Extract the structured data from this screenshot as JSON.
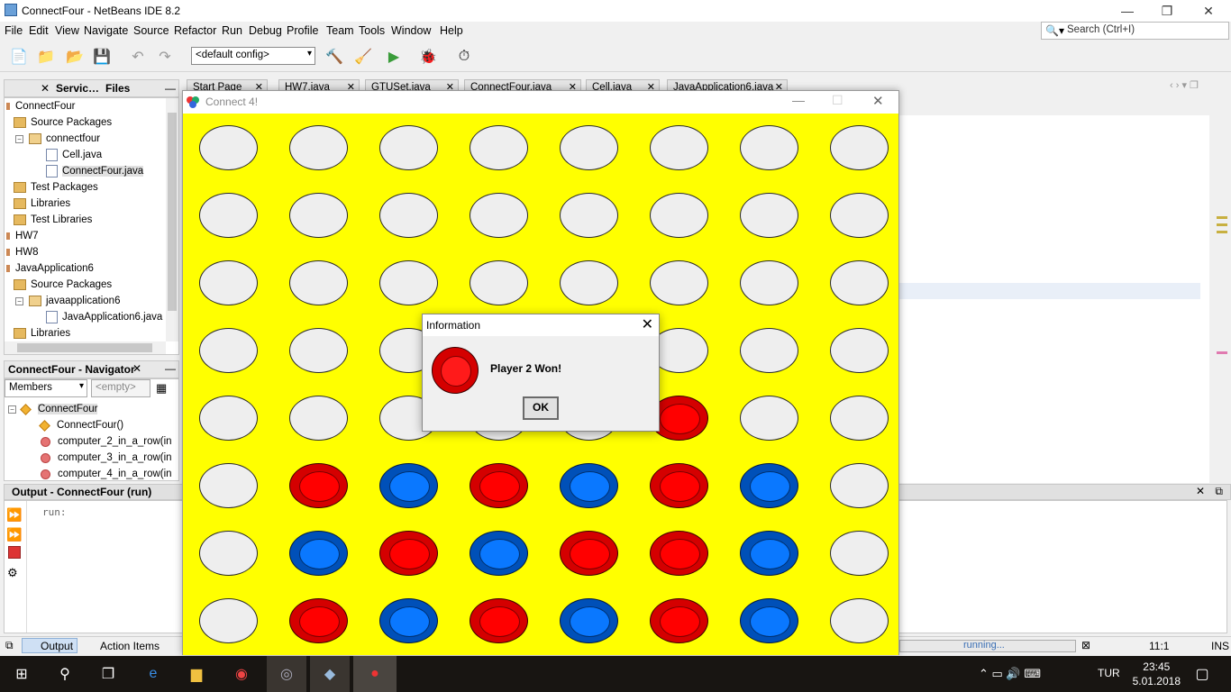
{
  "ide": {
    "title": "ConnectFour - NetBeans IDE 8.2",
    "menu": [
      "File",
      "Edit",
      "View",
      "Navigate",
      "Source",
      "Refactor",
      "Run",
      "Debug",
      "Profile",
      "Team",
      "Tools",
      "Window",
      "Help"
    ],
    "search_placeholder": "Search (Ctrl+I)",
    "config": "<default config>"
  },
  "projects_panel": {
    "tabs": [
      "Servic…",
      "Files"
    ],
    "tree": [
      {
        "label": "ConnectFour",
        "level": 0,
        "icon": "project-icon"
      },
      {
        "label": "Source Packages",
        "level": 1,
        "icon": "folder-icon"
      },
      {
        "label": "connectfour",
        "level": 2,
        "icon": "package-icon"
      },
      {
        "label": "Cell.java",
        "level": 3,
        "icon": "java-file-icon"
      },
      {
        "label": "ConnectFour.java",
        "level": 3,
        "icon": "java-file-icon"
      },
      {
        "label": "Test Packages",
        "level": 1,
        "icon": "folder-icon"
      },
      {
        "label": "Libraries",
        "level": 1,
        "icon": "folder-icon"
      },
      {
        "label": "Test Libraries",
        "level": 1,
        "icon": "folder-icon"
      },
      {
        "label": "HW7",
        "level": 0,
        "icon": "project-icon"
      },
      {
        "label": "HW8",
        "level": 0,
        "icon": "project-icon"
      },
      {
        "label": "JavaApplication6",
        "level": 0,
        "icon": "project-icon"
      },
      {
        "label": "Source Packages",
        "level": 1,
        "icon": "folder-icon"
      },
      {
        "label": "javaapplication6",
        "level": 2,
        "icon": "package-icon"
      },
      {
        "label": "JavaApplication6.java",
        "level": 3,
        "icon": "java-file-icon"
      },
      {
        "label": "Libraries",
        "level": 1,
        "icon": "folder-icon"
      }
    ]
  },
  "navigator": {
    "title": "ConnectFour - Navigator",
    "members": "Members",
    "filter": "<empty>",
    "items": [
      {
        "label": "ConnectFour",
        "icon": "class-icon"
      },
      {
        "label": "ConnectFour()",
        "icon": "constructor-icon"
      },
      {
        "label": "computer_2_in_a_row(in",
        "icon": "method-icon"
      },
      {
        "label": "computer_3_in_a_row(in",
        "icon": "method-icon"
      },
      {
        "label": "computer_4_in_a_row(in",
        "icon": "method-icon"
      }
    ]
  },
  "editor_tabs": [
    "Start Page",
    "HW7.java",
    "GTUSet.java",
    "ConnectFour.java",
    "Cell.java",
    "JavaApplication6.java"
  ],
  "output": {
    "title": "Output - ConnectFour (run)",
    "text": "run:"
  },
  "statusbar": {
    "tabs": [
      "Output",
      "Action Items"
    ],
    "running": "running...",
    "position": "11:1",
    "mode": "INS"
  },
  "game": {
    "title": "Connect 4!",
    "board": [
      [
        "empty",
        "empty",
        "empty",
        "empty",
        "empty",
        "empty",
        "empty",
        "empty"
      ],
      [
        "empty",
        "empty",
        "empty",
        "empty",
        "empty",
        "empty",
        "empty",
        "empty"
      ],
      [
        "empty",
        "empty",
        "empty",
        "empty",
        "empty",
        "empty",
        "empty",
        "empty"
      ],
      [
        "empty",
        "empty",
        "empty",
        "empty",
        "empty",
        "empty",
        "empty",
        "empty"
      ],
      [
        "empty",
        "empty",
        "empty",
        "empty",
        "empty",
        "red",
        "empty",
        "empty"
      ],
      [
        "empty",
        "red",
        "blue",
        "red",
        "blue",
        "red",
        "blue",
        "empty"
      ],
      [
        "empty",
        "blue",
        "red",
        "blue",
        "red",
        "red",
        "blue",
        "empty"
      ],
      [
        "empty",
        "red",
        "blue",
        "red",
        "blue",
        "red",
        "blue",
        "empty"
      ]
    ]
  },
  "dialog": {
    "title": "Information",
    "message": "Player 2 Won!",
    "ok": "OK"
  },
  "taskbar": {
    "lang": "TUR",
    "time": "23:45",
    "date": "5.01.2018"
  }
}
